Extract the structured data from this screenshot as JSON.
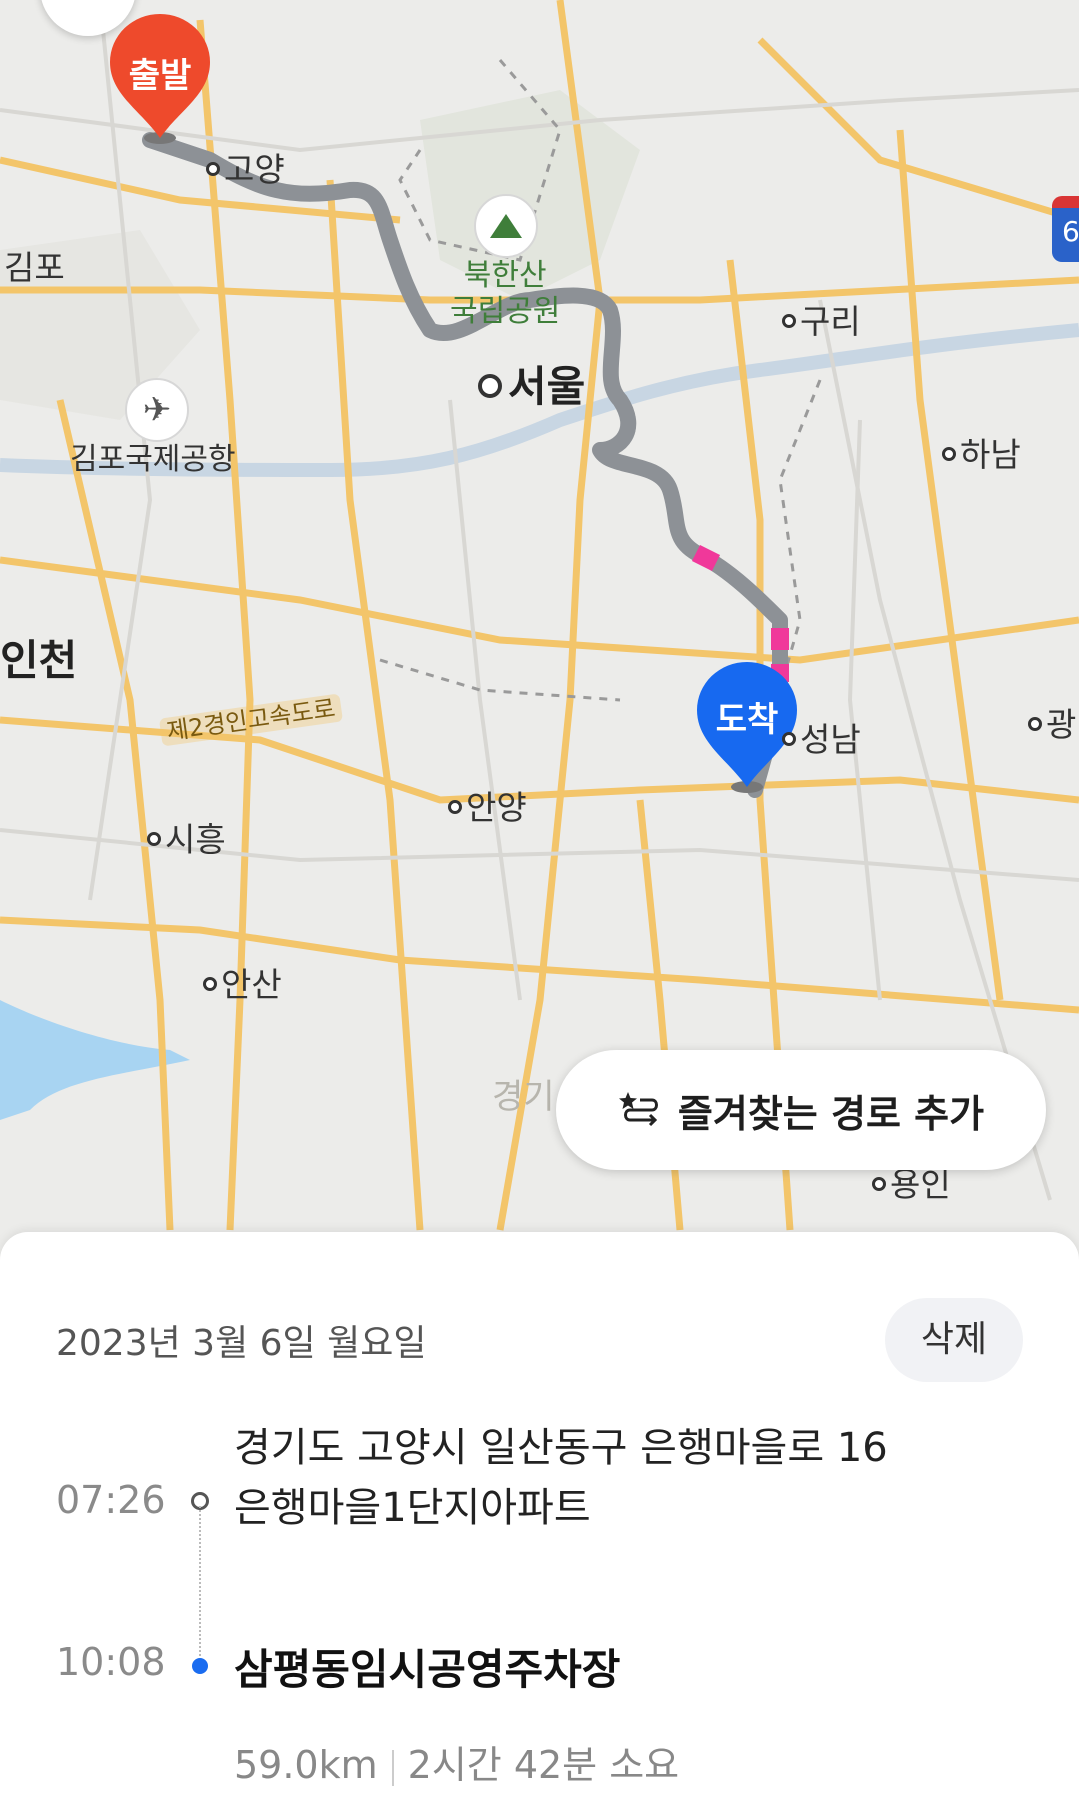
{
  "map": {
    "places": {
      "goyang": "고양",
      "gimpo": "김포",
      "gimpo_airport": "김포국제공항",
      "bukhansan": "북한산",
      "national_park": "국립공원",
      "seoul": "서울",
      "guri": "구리",
      "hanam": "하남",
      "incheon": "인천",
      "expressway": "제2경인고속도로",
      "seongnam": "성남",
      "anyang": "안양",
      "siheung": "시흥",
      "ansan": "안산",
      "gyeonggi": "경기",
      "yongin": "용인",
      "gwangju": "광",
      "route_badge": "6"
    },
    "start_pin": "출발",
    "end_pin": "도착",
    "favorite_route_label": "즐겨찾는 경로 추가"
  },
  "trip": {
    "date": "2023년 3월 6일 월요일",
    "delete_label": "삭제",
    "start_time": "07:26",
    "start_address_line1": "경기도 고양시 일산동구 은행마을로 16",
    "start_address_line2": "은행마을1단지아파트",
    "end_time": "10:08",
    "end_name": "삼평동임시공영주차장",
    "distance": "59.0km",
    "duration": "2시간 42분 소요"
  },
  "colors": {
    "route_normal": "#8d9196",
    "route_congested": "#f0389a",
    "start_pin": "#ee4a2c",
    "end_pin": "#1769f0",
    "end_dot": "#1a6cf0"
  }
}
